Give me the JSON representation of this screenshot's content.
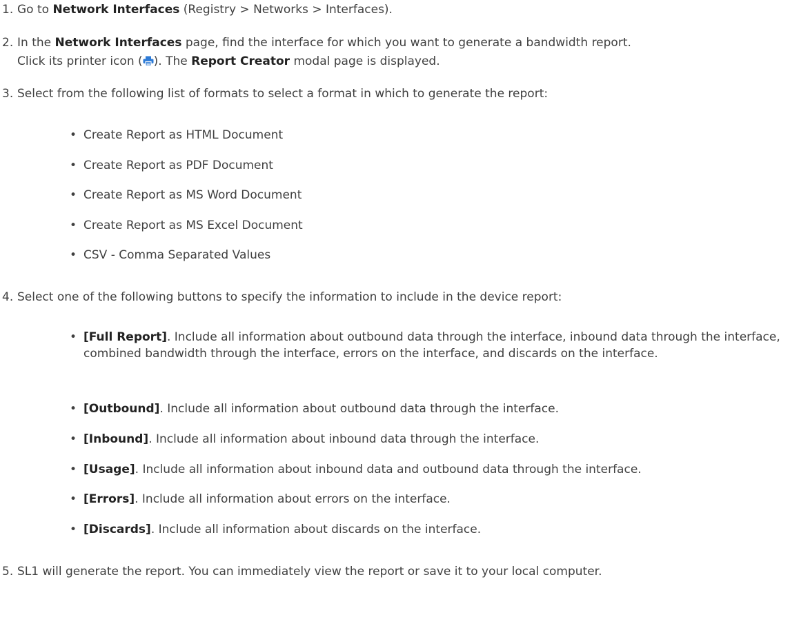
{
  "steps": [
    {
      "number": "1.",
      "pre": "Go to ",
      "bold": "Network Interfaces",
      "post": " (Registry > Networks > Interfaces)."
    },
    {
      "number": "2.",
      "line1_pre": "In the ",
      "line1_bold": "Network Interfaces",
      "line1_post": " page, find the interface for which you want to generate a bandwidth report.",
      "line2_pre": "Click its printer icon (",
      "line2_mid": "). The ",
      "line2_bold": "Report Creator",
      "line2_post": " modal page is displayed.",
      "icon": "printer-icon"
    },
    {
      "number": "3.",
      "text": "Select from the following list of formats to select a format in which to generate the report:",
      "bullets": [
        "Create Report as HTML Document",
        "Create Report as PDF Document",
        "Create Report as MS Word Document",
        "Create Report as MS Excel Document",
        "CSV - Comma Separated Values"
      ]
    },
    {
      "number": "4.",
      "text": "Select one of the following buttons to specify the information to include in the device report:",
      "bullets": [
        {
          "bold": "[Full Report]",
          "text": ". Include all information about outbound data through the interface, inbound data through the interface, combined bandwidth through the interface, errors on the interface, and discards on the interface."
        },
        {
          "bold": "[Outbound]",
          "text": ". Include all information about outbound data through the interface."
        },
        {
          "bold": "[Inbound]",
          "text": ". Include all information about inbound data through the interface."
        },
        {
          "bold": "[Usage]",
          "text": ". Include all information about inbound data and outbound data through the interface."
        },
        {
          "bold": "[Errors]",
          "text": ". Include all information about errors on the interface."
        },
        {
          "bold": "[Discards]",
          "text": ". Include all information about discards on the interface."
        }
      ]
    },
    {
      "number": "5.",
      "text": "SL1 will generate the report. You can immediately view the report or save it to your local computer."
    }
  ],
  "bullet_char": "•",
  "colors": {
    "text": "#404040",
    "bold": "#222222",
    "icon": "#2e7bd6"
  }
}
